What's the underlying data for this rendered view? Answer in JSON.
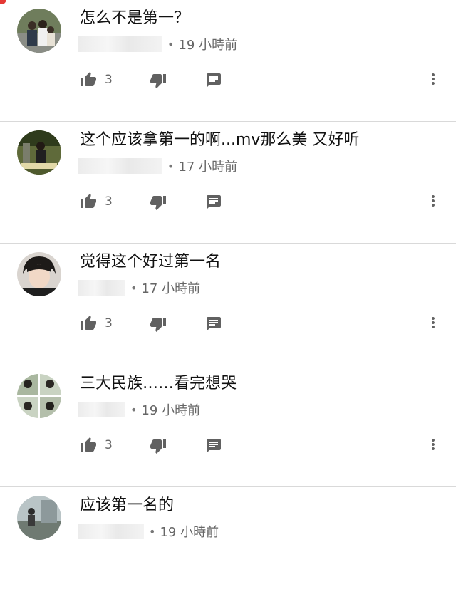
{
  "comments": [
    {
      "text": "怎么不是第一？",
      "time": "19 小時前",
      "likes": "3",
      "name_width": 118
    },
    {
      "text": "这个应该拿第一的啊...mv那么美 又好听",
      "time": "17 小時前",
      "likes": "3",
      "name_width": 118
    },
    {
      "text": "觉得这个好过第一名",
      "time": "17 小時前",
      "likes": "3",
      "name_width": 66
    },
    {
      "text": "三大民族……看完想哭",
      "time": "19 小時前",
      "likes": "3",
      "name_width": 66
    },
    {
      "text": "应该第一名的",
      "time": "19 小時前",
      "likes": "",
      "name_width": 92
    }
  ],
  "meta_separator": "•",
  "icons": {
    "like": "thumb-up-icon",
    "dislike": "thumb-down-icon",
    "reply": "reply-comment-icon",
    "more": "more-vertical-icon"
  },
  "colors": {
    "icon": "#616161",
    "divider": "#d9d9d9",
    "meta_text": "#666666",
    "notification_dot": "#e53935"
  }
}
